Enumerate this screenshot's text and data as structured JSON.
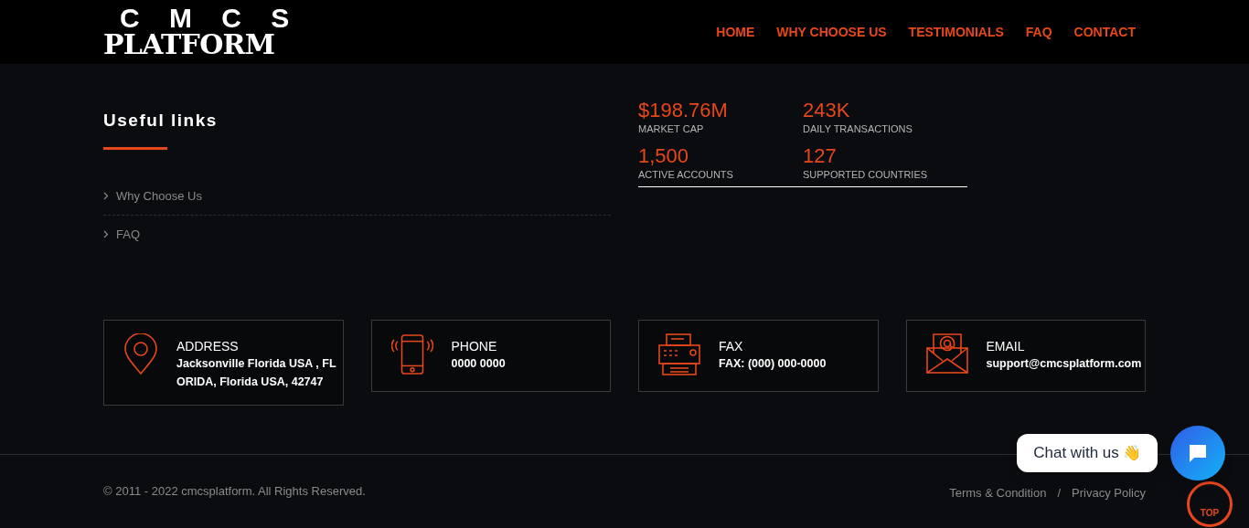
{
  "logo": {
    "line1": "C M C S",
    "line2": "PLATFORM"
  },
  "nav": [
    {
      "label": "HOME"
    },
    {
      "label": "WHY CHOOSE US"
    },
    {
      "label": "TESTIMONIALS"
    },
    {
      "label": "FAQ"
    },
    {
      "label": "CONTACT"
    }
  ],
  "useful_links": {
    "title": "Useful links",
    "items": [
      {
        "label": "Why Choose Us"
      },
      {
        "label": "FAQ"
      }
    ]
  },
  "stats": [
    {
      "value": "$198.76M",
      "label": "MARKET CAP"
    },
    {
      "value": "243K",
      "label": "DAILY TRANSACTIONS"
    },
    {
      "value": "1,500",
      "label": "ACTIVE ACCOUNTS"
    },
    {
      "value": "127",
      "label": "SUPPORTED COUNTRIES"
    }
  ],
  "contacts": [
    {
      "kind": "address",
      "title": "ADDRESS",
      "lines": [
        "Jacksonville Florida USA , FL",
        "ORIDA, Florida USA, 42747"
      ]
    },
    {
      "kind": "phone",
      "title": "PHONE",
      "lines": [
        "0000 0000"
      ]
    },
    {
      "kind": "fax",
      "title": "FAX",
      "lines": [
        "FAX: (000) 000-0000"
      ]
    },
    {
      "kind": "email",
      "title": "EMAIL",
      "lines": [
        "support@cmcsplatform.com"
      ]
    }
  ],
  "footer": {
    "copyright": "© 2011 - 2022 cmcsplatform. All Rights Reserved.",
    "links": [
      "Terms & Condition",
      "Privacy Policy"
    ],
    "separator": "/"
  },
  "chat": {
    "label": "Chat with us",
    "emoji": "👋"
  },
  "top_button": {
    "label": "TOP"
  }
}
